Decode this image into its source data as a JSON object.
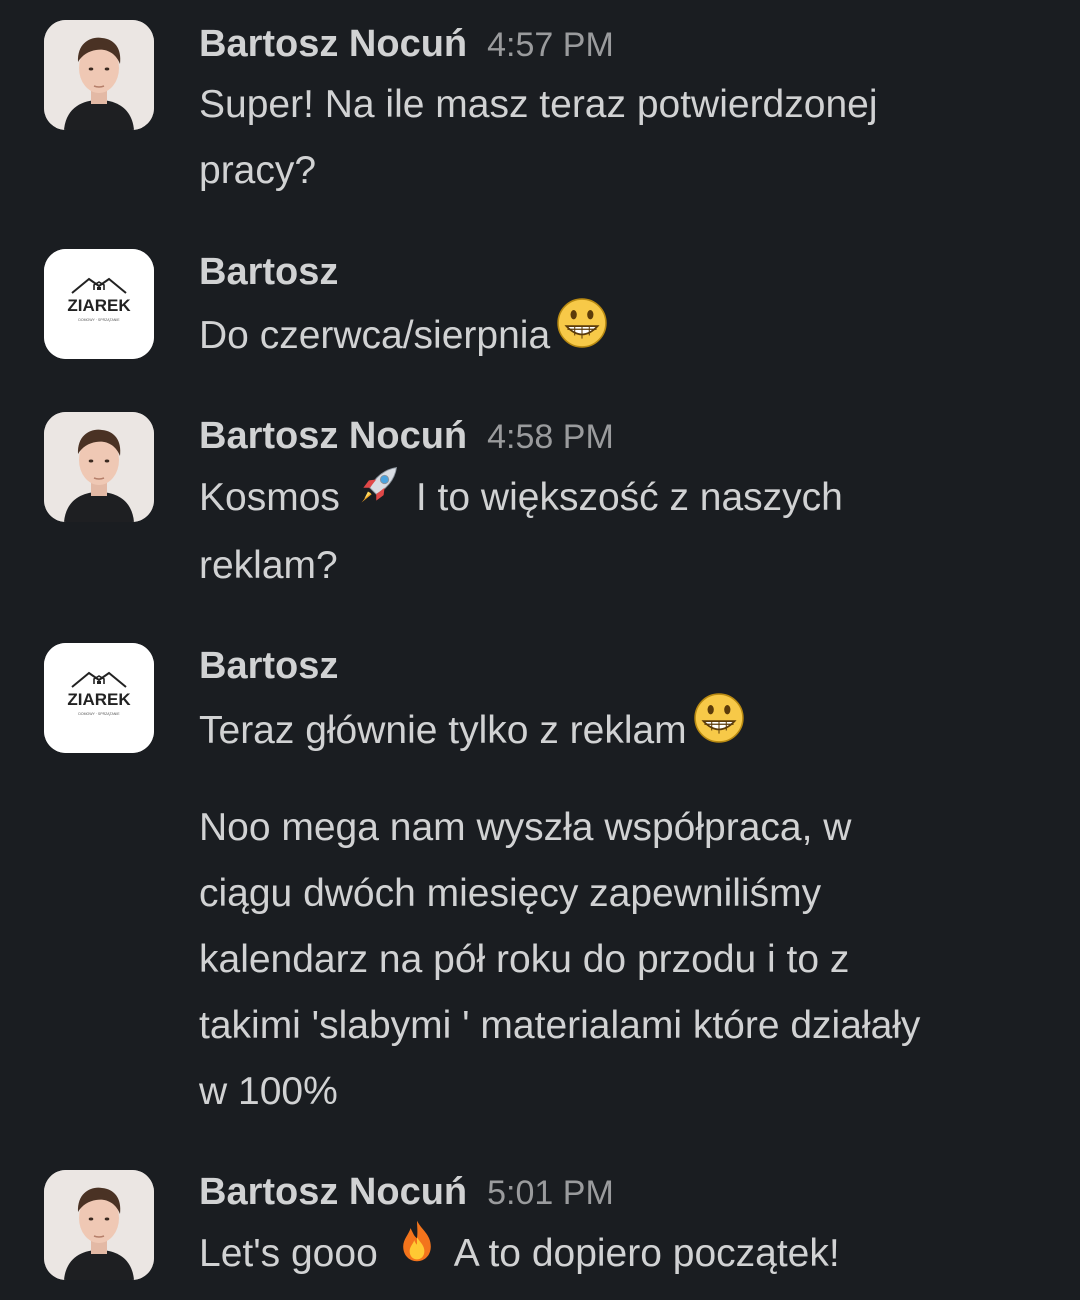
{
  "messages": [
    {
      "author": "Bartosz Nocuń",
      "time": "4:57 PM",
      "avatar": "person-photo-avatar",
      "lines": [
        "Super! Na ile masz teraz potwierdzonej",
        "pracy?"
      ]
    },
    {
      "author": "Bartosz",
      "avatar": "ziarek-logo-avatar",
      "logo_text": "ZIAREK",
      "text_before": "Do czerwca/sierpnia",
      "emoji": "grinning-face-emoji"
    },
    {
      "author": "Bartosz Nocuń",
      "time": "4:58 PM",
      "avatar": "person-photo-avatar",
      "text_before": "Kosmos",
      "emoji": "rocket-emoji",
      "text_after": "I to większość z naszych",
      "line2": "reklam?"
    },
    {
      "author": "Bartosz",
      "avatar": "ziarek-logo-avatar",
      "logo_text": "ZIAREK",
      "text_before": "Teraz głównie tylko z reklam",
      "emoji": "grinning-face-emoji",
      "paragraph_lines": [
        "Noo mega nam wyszła współpraca, w",
        "ciągu dwóch miesięcy zapewniliśmy",
        "kalendarz na pół roku do przodu i to z",
        "takimi 'slabymi ' materialami które działały",
        "w 100%"
      ]
    },
    {
      "author": "Bartosz Nocuń",
      "time": "5:01 PM",
      "avatar": "person-photo-avatar",
      "text_before": "Let's gooo",
      "emoji": "fire-emoji",
      "text_after": "A to dopiero początek!"
    }
  ],
  "colors": {
    "background": "#1a1d21",
    "text": "#d1d2d3",
    "timestamp": "#9a9b9d"
  }
}
